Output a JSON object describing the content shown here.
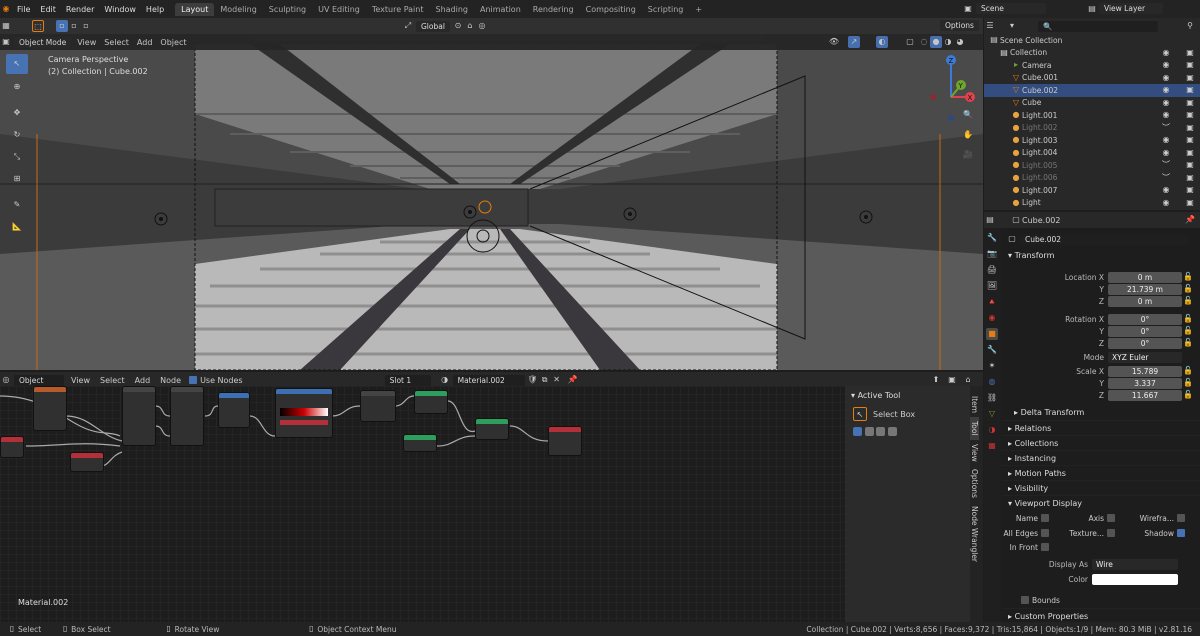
{
  "topbar": {
    "menus": [
      "File",
      "Edit",
      "Render",
      "Window",
      "Help"
    ],
    "workspaces": [
      "Layout",
      "Modeling",
      "Sculpting",
      "UV Editing",
      "Texture Paint",
      "Shading",
      "Animation",
      "Rendering",
      "Compositing",
      "Scripting"
    ],
    "active_workspace": "Layout",
    "scene": "Scene",
    "view_layer": "View Layer"
  },
  "viewport_header": {
    "mode": "Object Mode",
    "menus": [
      "View",
      "Select",
      "Add",
      "Object"
    ],
    "transform": "Global",
    "options": "Options"
  },
  "viewport": {
    "camera_label": "Camera Perspective",
    "collection_label": "(2) Collection | Cube.002"
  },
  "node_header": {
    "editor": "Object",
    "menus": [
      "View",
      "Select",
      "Add",
      "Node"
    ],
    "use_nodes": "Use Nodes",
    "slot": "Slot 1",
    "material": "Material.002"
  },
  "node_editor": {
    "material_label": "Material.002"
  },
  "n_panel": {
    "title": "Active Tool",
    "tool": "Select Box",
    "tabs": [
      "Item",
      "Tool",
      "View",
      "Options",
      "Node Wrangler"
    ]
  },
  "outliner": {
    "title": "Scene Collection",
    "items": [
      {
        "name": "Collection",
        "dim": false
      },
      {
        "name": "Camera",
        "dim": false
      },
      {
        "name": "Cube.001",
        "dim": false
      },
      {
        "name": "Cube.002",
        "dim": false
      },
      {
        "name": "Cube",
        "dim": false
      },
      {
        "name": "Light.001",
        "dim": false
      },
      {
        "name": "Light.002",
        "dim": true
      },
      {
        "name": "Light.003",
        "dim": false
      },
      {
        "name": "Light.004",
        "dim": false
      },
      {
        "name": "Light.005",
        "dim": true
      },
      {
        "name": "Light.006",
        "dim": true
      },
      {
        "name": "Light.007",
        "dim": false
      },
      {
        "name": "Light",
        "dim": false
      }
    ],
    "selected": "Cube.002"
  },
  "properties": {
    "object_name": "Cube.002",
    "object_field": "Cube.002",
    "transform_title": "Transform",
    "location_x_label": "Location X",
    "location": [
      "0 m",
      "21.739 m",
      "0 m"
    ],
    "rotation_x_label": "Rotation X",
    "rotation": [
      "0°",
      "0°",
      "0°"
    ],
    "mode_label": "Mode",
    "mode": "XYZ Euler",
    "scale_x_label": "Scale X",
    "scale": [
      "15.789",
      "3.337",
      "11.667"
    ],
    "y_label": "Y",
    "z_label": "Z",
    "delta_transform": "Delta Transform",
    "sections": [
      "Relations",
      "Collections",
      "Instancing",
      "Motion Paths",
      "Visibility"
    ],
    "viewport_display": "Viewport Display",
    "name_label": "Name",
    "axis_label": "Axis",
    "wireframe_label": "Wirefra...",
    "all_edges_label": "All Edges",
    "texture_label": "Texture...",
    "shadow_label": "Shadow",
    "in_front_label": "In Front",
    "display_as_label": "Display As",
    "display_as": "Wire",
    "color_label": "Color",
    "bounds_label": "Bounds",
    "custom_properties": "Custom Properties"
  },
  "statusbar": {
    "select": "Select",
    "box_select": "Box Select",
    "rotate_view": "Rotate View",
    "context_menu": "Object Context Menu",
    "stats": "Collection | Cube.002 | Verts:8,656 | Faces:9,372 | Tris:15,864 | Objects:1/9 | Mem: 80.3 MiB | v2.81.16"
  },
  "colors": {
    "accent": "#4772b3",
    "selected_row": "#334d80",
    "gizmo_x": "#e0414d",
    "gizmo_y": "#6fa62b",
    "gizmo_z": "#3c7bd6"
  }
}
